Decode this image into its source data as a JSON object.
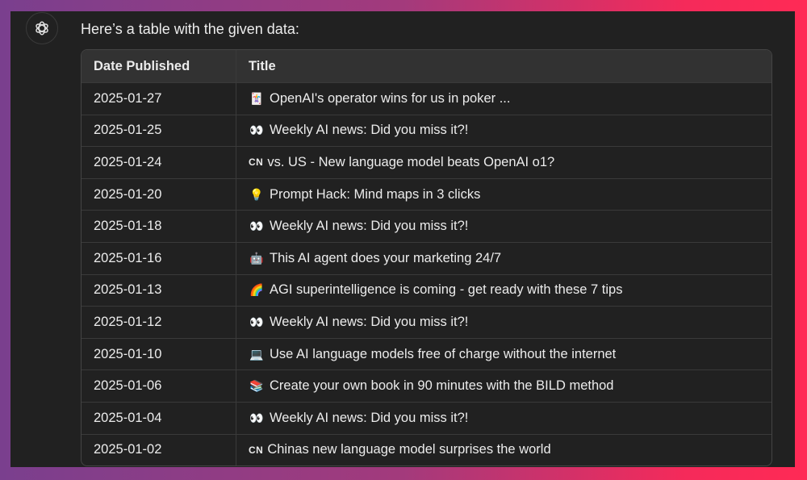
{
  "intro": "Here’s a table with the given data:",
  "table": {
    "headers": [
      "Date Published",
      "Title"
    ],
    "rows": [
      {
        "date": "2025-01-27",
        "icon": "🃏",
        "title": "OpenAI's operator wins for us in poker ..."
      },
      {
        "date": "2025-01-25",
        "icon": "👀",
        "title": "Weekly AI news: Did you miss it?!"
      },
      {
        "date": "2025-01-24",
        "icon": "CN",
        "title": "vs. US - New language model beats OpenAI o1?"
      },
      {
        "date": "2025-01-20",
        "icon": "💡",
        "title": "Prompt Hack: Mind maps in 3 clicks"
      },
      {
        "date": "2025-01-18",
        "icon": "👀",
        "title": "Weekly AI news: Did you miss it?!"
      },
      {
        "date": "2025-01-16",
        "icon": "🤖",
        "title": "This AI agent does your marketing 24/7"
      },
      {
        "date": "2025-01-13",
        "icon": "🌈",
        "title": "AGI superintelligence is coming - get ready with these 7 tips"
      },
      {
        "date": "2025-01-12",
        "icon": "👀",
        "title": "Weekly AI news: Did you miss it?!"
      },
      {
        "date": "2025-01-10",
        "icon": "💻",
        "title": "Use AI language models free of charge without the internet"
      },
      {
        "date": "2025-01-06",
        "icon": "📚",
        "title": "Create your own book in 90 minutes with the BILD method"
      },
      {
        "date": "2025-01-04",
        "icon": "👀",
        "title": "Weekly AI news: Did you miss it?!"
      },
      {
        "date": "2025-01-02",
        "icon": "CN",
        "title": "Chinas new language model surprises the world"
      }
    ]
  }
}
